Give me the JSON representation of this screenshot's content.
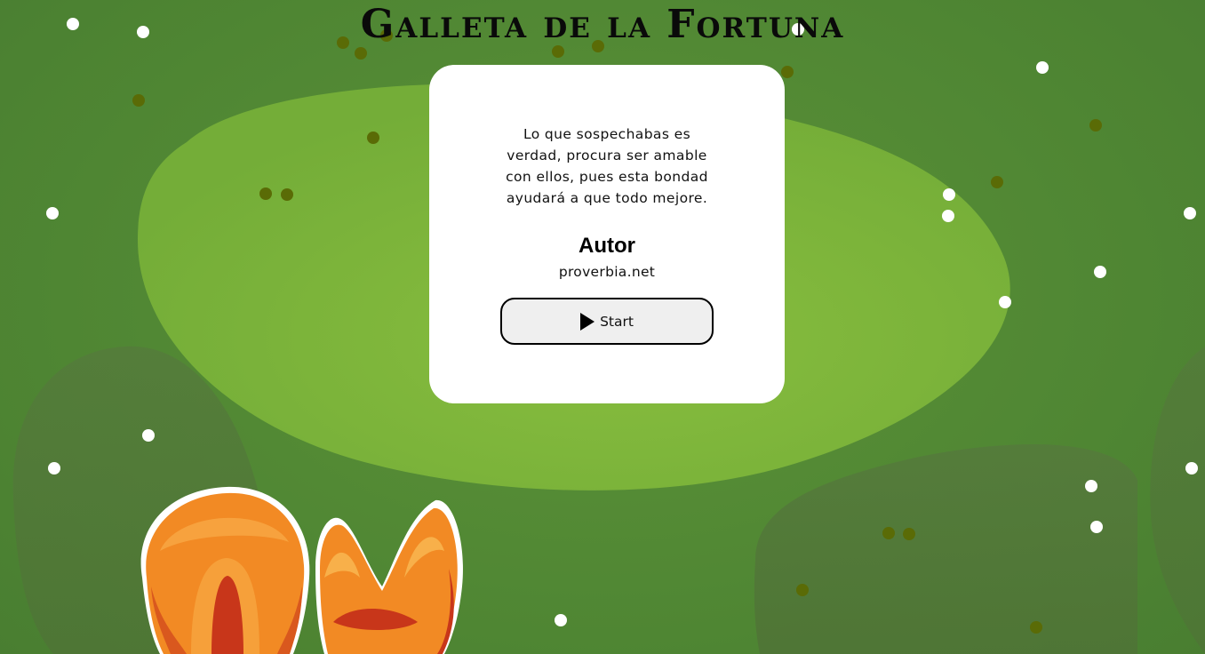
{
  "page": {
    "title": "Galleta de la Fortuna"
  },
  "card": {
    "quote": "Lo que sospechabas es verdad, procura ser amable con ellos, pues esta bondad ayudará a que todo mejore.",
    "author_heading": "Autor",
    "author_name": "proverbia.net",
    "start_label": "Start",
    "start_icon": "play-icon"
  },
  "colors": {
    "background": "#4f8633",
    "blob_light": "#7cb63c",
    "blob_dark": "#567a3a",
    "dot_white": "#ffffff",
    "dot_olive": "#5a6b06",
    "cookie_orange": "#f28a24"
  }
}
